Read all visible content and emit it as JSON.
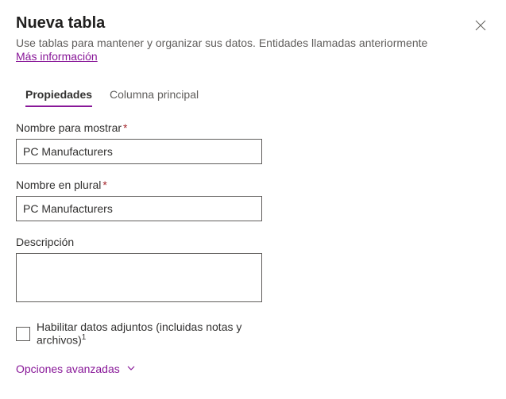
{
  "header": {
    "title": "Nueva tabla",
    "subtitle": "Use tablas para mantener y organizar sus datos. Entidades llamadas anteriormente",
    "more_info": "Más información"
  },
  "tabs": {
    "properties": "Propiedades",
    "primary_column": "Columna principal"
  },
  "form": {
    "display_name_label": "Nombre para mostrar",
    "display_name_value": "PC Manufacturers",
    "plural_label": "Nombre en plural",
    "plural_value": "PC Manufacturers",
    "description_label": "Descripción",
    "description_value": "",
    "attachments_label": "Habilitar datos adjuntos (incluidas notas y archivos)",
    "attachments_sup": "1",
    "advanced_label": "Opciones avanzadas"
  },
  "required_marker": "*"
}
